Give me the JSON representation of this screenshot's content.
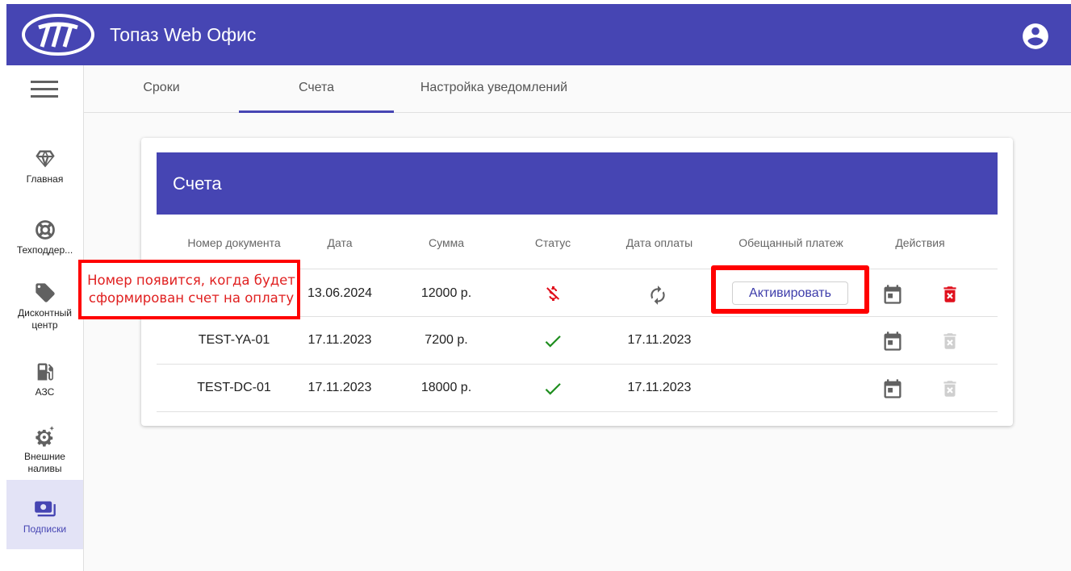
{
  "app": {
    "title": "Топаз Web Офис"
  },
  "sidebar": {
    "items": [
      {
        "label": "Главная",
        "icon": "diamond-icon"
      },
      {
        "label": "Техподдер...",
        "icon": "lifebuoy-icon"
      },
      {
        "label": "Дисконтный центр",
        "icon": "tag-icon"
      },
      {
        "label": "АЗС",
        "icon": "fuel-station-icon"
      },
      {
        "label": "Внешние наливы",
        "icon": "gears-icon"
      },
      {
        "label": "Подписки",
        "icon": "subscriptions-icon"
      }
    ]
  },
  "tabs": [
    {
      "label": "Сроки"
    },
    {
      "label": "Счета",
      "active": true
    },
    {
      "label": "Настройка уведомлений"
    }
  ],
  "card": {
    "title": "Счета",
    "columns": [
      "Номер документа",
      "Дата",
      "Сумма",
      "Статус",
      "Дата оплаты",
      "Обещанный платеж",
      "Действия"
    ],
    "rows": [
      {
        "doc": "",
        "date": "13.06.2024",
        "sum": "12000 р.",
        "status": "unpaid",
        "paid_date": "",
        "promise_button": "Активировать"
      },
      {
        "doc": "TEST-YA-01",
        "date": "17.11.2023",
        "sum": "7200 р.",
        "status": "paid",
        "paid_date": "17.11.2023"
      },
      {
        "doc": "TEST-DC-01",
        "date": "17.11.2023",
        "sum": "18000 р.",
        "status": "paid",
        "paid_date": "17.11.2023"
      }
    ]
  },
  "annotation": {
    "line1": "Номер появится, когда будет",
    "line2": "сформирован счет на оплату"
  },
  "colors": {
    "primary": "#4645b3",
    "danger": "#e0101d",
    "success": "#1e8e1e",
    "annotation": "#ff0000"
  }
}
